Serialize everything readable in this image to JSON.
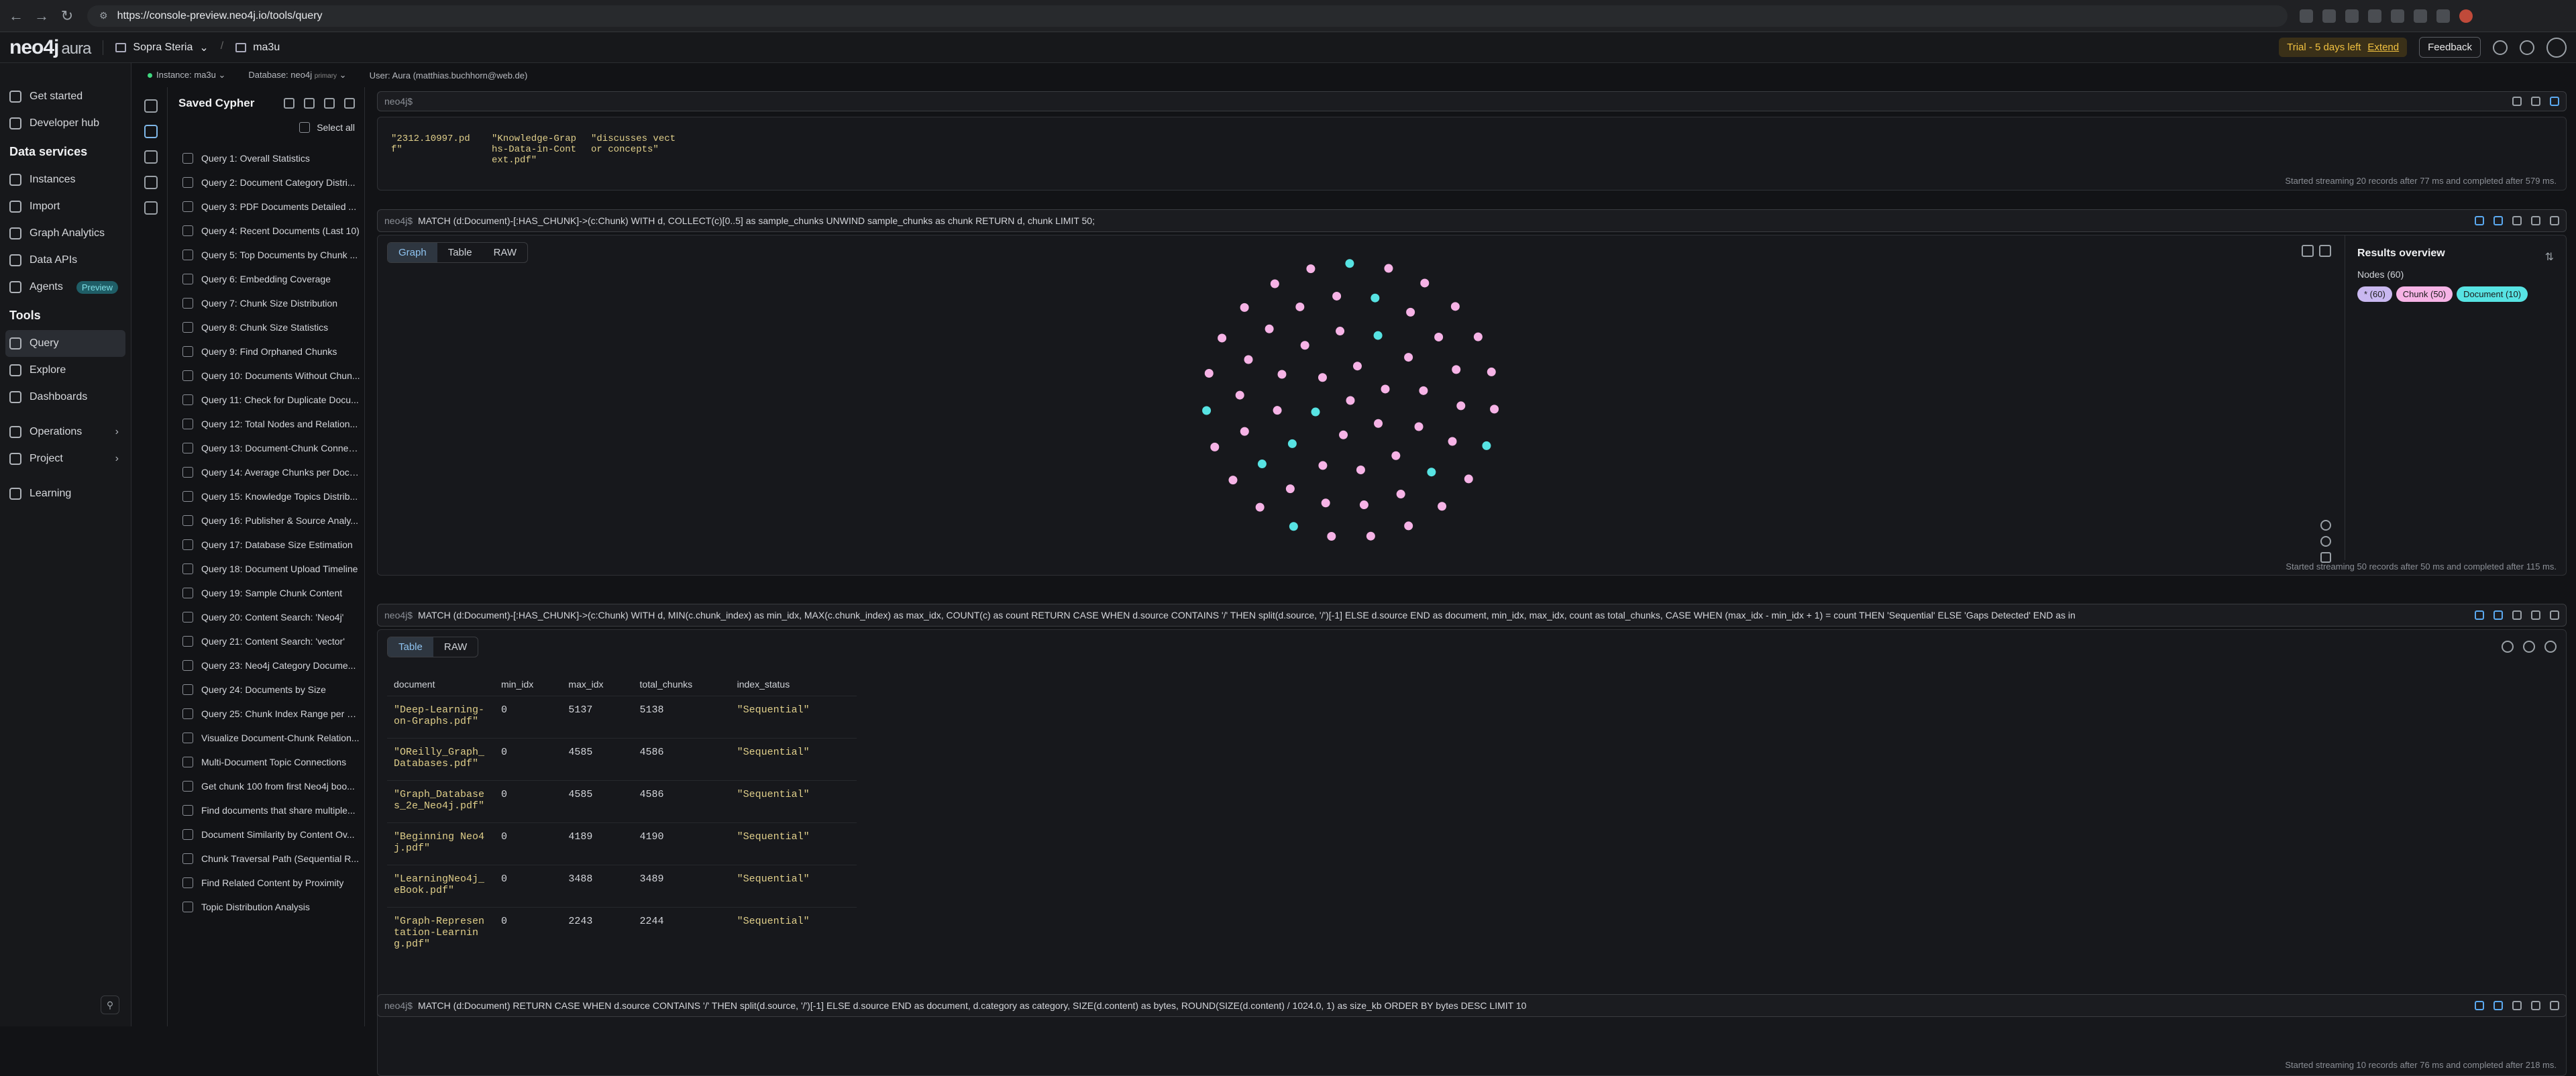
{
  "browser": {
    "url": "https://console-preview.neo4j.io/tools/query"
  },
  "header": {
    "logo": "neo4j",
    "logo_suffix": "aura",
    "org": "Sopra Steria",
    "project": "ma3u",
    "trial_text": "Trial - 5 days left",
    "extend": "Extend",
    "feedback": "Feedback"
  },
  "subbar": {
    "instance": "Instance: ma3u",
    "database": "Database: neo4j",
    "database_tag": "primary",
    "user": "User: Aura (matthias.buchhorn@web.de)"
  },
  "nav": {
    "get_started": "Get started",
    "developer_hub": "Developer hub",
    "data_services": "Data services",
    "instances": "Instances",
    "import": "Import",
    "graph_analytics": "Graph Analytics",
    "data_apis": "Data APIs",
    "agents": "Agents",
    "preview": "Preview",
    "tools": "Tools",
    "query": "Query",
    "explore": "Explore",
    "dashboards": "Dashboards",
    "operations": "Operations",
    "project": "Project",
    "learning": "Learning"
  },
  "saved": {
    "title": "Saved Cypher",
    "select_all": "Select all",
    "queries": [
      "Query 1: Overall Statistics",
      "Query 2: Document Category Distri...",
      "Query 3: PDF Documents Detailed ...",
      "Query 4: Recent Documents (Last 10)",
      "Query 5: Top Documents by Chunk ...",
      "Query 6: Embedding Coverage",
      "Query 7: Chunk Size Distribution",
      "Query 8: Chunk Size Statistics",
      "Query 9: Find Orphaned Chunks",
      "Query 10: Documents Without Chun...",
      "Query 11: Check for Duplicate Docu...",
      "Query 12: Total Nodes and Relation...",
      "Query 13: Document-Chunk Connec...",
      "Query 14: Average Chunks per Docu...",
      "Query 15: Knowledge Topics Distrib...",
      "Query 16: Publisher & Source Analy...",
      "Query 17: Database Size Estimation",
      "Query 18: Document Upload Timeline",
      "Query 19: Sample Chunk Content",
      "Query 20: Content Search: 'Neo4j'",
      "Query 21: Content Search: 'vector'",
      "Query 23: Neo4j Category Docume...",
      "Query 24: Documents by Size",
      "Query 25: Chunk Index Range per D...",
      "Visualize Document-Chunk Relation...",
      "Multi-Document Topic Connections",
      "Get chunk 100 from first Neo4j boo...",
      "Find documents that share multiple...",
      "Document Similarity by Content Ov...",
      "Chunk Traversal Path (Sequential R...",
      "Find Related Content by Proximity",
      "Topic Distribution Analysis"
    ]
  },
  "editor": {
    "prompt": "neo4j$"
  },
  "top_card": {
    "row_c1": "\"2312.10997.pd\nf\"",
    "row_c2": "\"Knowledge-Grap\nhs-Data-in-Cont\next.pdf\"",
    "row_c3": "\"discusses vect\nor concepts\"",
    "status": "Started streaming 20 records after 77 ms and completed after 579 ms."
  },
  "q1": {
    "prompt": "neo4j$",
    "cmd": "MATCH (d:Document)-[:HAS_CHUNK]->(c:Chunk) WITH d, COLLECT(c)[0..5] as sample_chunks UNWIND sample_chunks as chunk RETURN d, chunk LIMIT 50;",
    "tabs": [
      "Graph",
      "Table",
      "RAW"
    ],
    "results_title": "Results overview",
    "nodes_label": "Nodes (60)",
    "pill_all": "* (60)",
    "pill_chunk": "Chunk (50)",
    "pill_doc": "Document (10)",
    "status": "Started streaming 50 records after 50 ms and completed after 115 ms."
  },
  "q2": {
    "prompt": "neo4j$",
    "cmd": "MATCH (d:Document)-[:HAS_CHUNK]->(c:Chunk) WITH d, MIN(c.chunk_index) as min_idx, MAX(c.chunk_index) as max_idx, COUNT(c) as count RETURN CASE WHEN d.source CONTAINS '/' THEN split(d.source, '/')[-1] ELSE d.source END as document, min_idx, max_idx, count as total_chunks, CASE WHEN (max_idx - min_idx + 1) = count THEN 'Sequential' ELSE 'Gaps Detected' END as in",
    "tabs": [
      "Table",
      "RAW"
    ],
    "columns": [
      "document",
      "min_idx",
      "max_idx",
      "total_chunks",
      "index_status"
    ],
    "rows": [
      [
        "\"Deep-Learning-\non-Graphs.pdf\"",
        "0",
        "5137",
        "5138",
        "\"Sequential\""
      ],
      [
        "\"OReilly_Graph_\nDatabases.pdf\"",
        "0",
        "4585",
        "4586",
        "\"Sequential\""
      ],
      [
        "\"Graph_Database\ns_2e_Neo4j.pdf\"",
        "0",
        "4585",
        "4586",
        "\"Sequential\""
      ],
      [
        "\"Beginning Neo4\nj.pdf\"",
        "0",
        "4189",
        "4190",
        "\"Sequential\""
      ],
      [
        "\"LearningNeo4j_\neBook.pdf\"",
        "0",
        "3488",
        "3489",
        "\"Sequential\""
      ],
      [
        "\"Graph-Represen\ntation-Learnin\ng.pdf\"",
        "0",
        "2243",
        "2244",
        "\"Sequential\""
      ]
    ],
    "status": "Started streaming 10 records after 76 ms and completed after 218 ms."
  },
  "q3": {
    "prompt": "neo4j$",
    "cmd": "MATCH (d:Document) RETURN CASE WHEN d.source CONTAINS '/' THEN split(d.source, '/')[-1] ELSE d.source END as document, d.category as category, SIZE(d.content) as bytes, ROUND(SIZE(d.content) / 1024.0, 1) as size_kb ORDER BY bytes DESC LIMIT 10"
  },
  "colors": {
    "chunk": "#f6b3e6",
    "document": "#57e3e3",
    "accent": "#5aa9f0"
  }
}
